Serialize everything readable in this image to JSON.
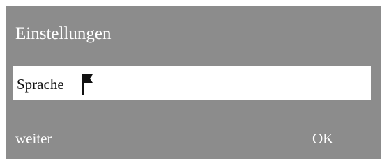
{
  "dialog": {
    "title": "Einstellungen",
    "setting_row": {
      "label": "Sprache",
      "icon": "flag-icon"
    },
    "buttons": {
      "next_label": "weiter",
      "ok_label": "OK"
    }
  },
  "colors": {
    "dialog_background": "#8c8c8c",
    "row_background": "#ffffff",
    "title_text": "#ffffff",
    "row_text": "#111111"
  }
}
